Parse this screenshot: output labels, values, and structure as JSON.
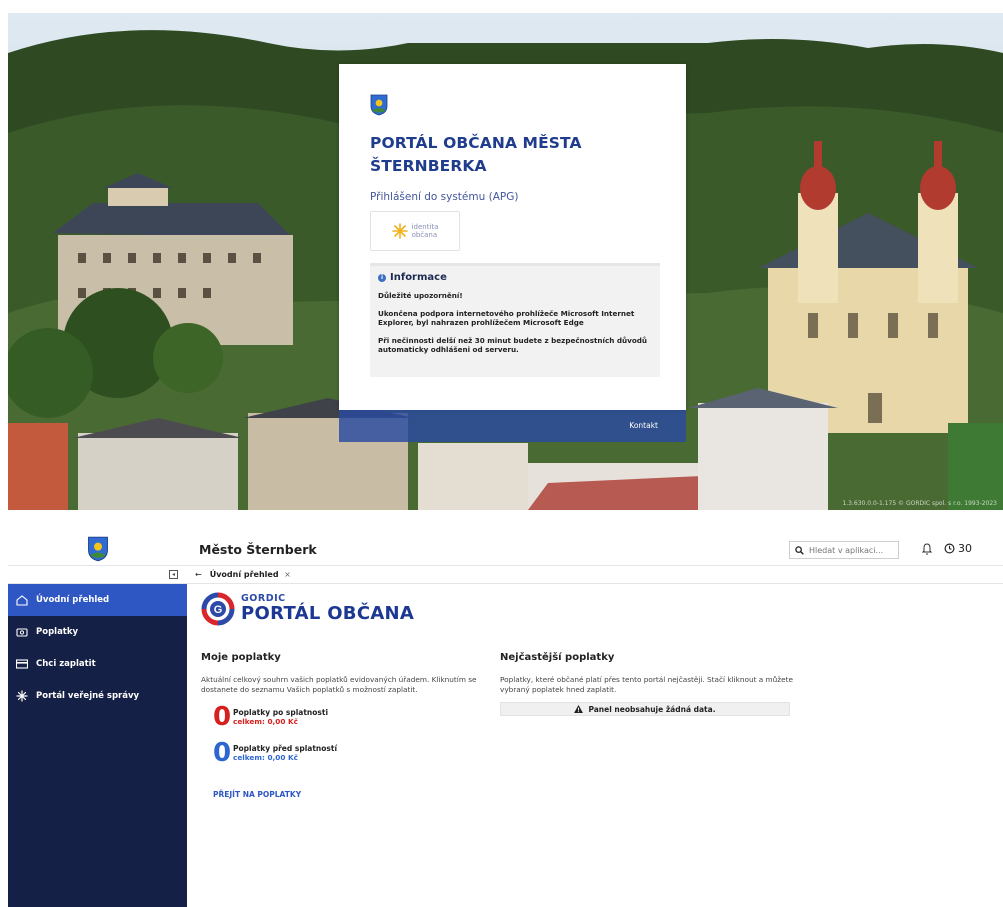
{
  "login": {
    "title": "PORTÁL OBČANA MĚSTA ŠTERNBERKA",
    "subtitle": "Přihlášení do systému (APG)",
    "identita": {
      "line1": "identita",
      "line2": "občana"
    },
    "info": {
      "heading": "Informace",
      "important": "Důležité upozornění!",
      "p1": "Ukončena podpora internetového prohlížeče Microsoft Internet Explorer, byl nahrazen prohlížečem Microsoft Edge",
      "p2": "Při nečinnosti delší než 30 minut budete z bezpečnostních důvodů automaticky odhlášeni od serveru."
    },
    "kontakt": "Kontakt",
    "copyright": "1.3.630.0.0-1.175 © GORDIC spol. s r.o. 1993-2023"
  },
  "app": {
    "title": "Město Šternberk",
    "search_placeholder": "Hledat v aplikaci...",
    "timer": "30",
    "sidebar": [
      {
        "label": "Úvodní přehled",
        "icon": "home-icon",
        "active": true
      },
      {
        "label": "Poplatky",
        "icon": "fees-icon",
        "active": false
      },
      {
        "label": "Chci zaplatit",
        "icon": "card-icon",
        "active": false
      },
      {
        "label": "Portál veřejné správy",
        "icon": "portal-icon",
        "active": false
      }
    ],
    "tab": {
      "back": "←",
      "label": "Úvodní přehled",
      "close": "×"
    },
    "logo": {
      "small": "GORDIC",
      "big": "PORTÁL OBČANA"
    },
    "moje": {
      "heading": "Moje poplatky",
      "desc": "Aktuální celkový souhrn vašich poplatků evidovaných úřadem. Kliknutím se dostanete do seznamu Vašich poplatků s možností zaplatit.",
      "po": {
        "count": "0",
        "title": "Poplatky po splatnosti",
        "sum": "celkem: 0,00 Kč"
      },
      "pred": {
        "count": "0",
        "title": "Poplatky před splatností",
        "sum": "celkem: 0,00 Kč"
      },
      "link": "PŘEJÍT NA POPLATKY"
    },
    "nejcastejsi": {
      "heading": "Nejčastější poplatky",
      "desc": "Poplatky, které občané platí přes tento portál nejčastěji. Stačí kliknout a můžete vybraný poplatek hned zaplatit.",
      "empty": "Panel neobsahuje žádná data."
    }
  },
  "colors": {
    "brand_blue": "#1f3d8c",
    "sidebar": "#152046",
    "active": "#2e57c4",
    "overdue": "#d62020",
    "due": "#2e66d0"
  }
}
